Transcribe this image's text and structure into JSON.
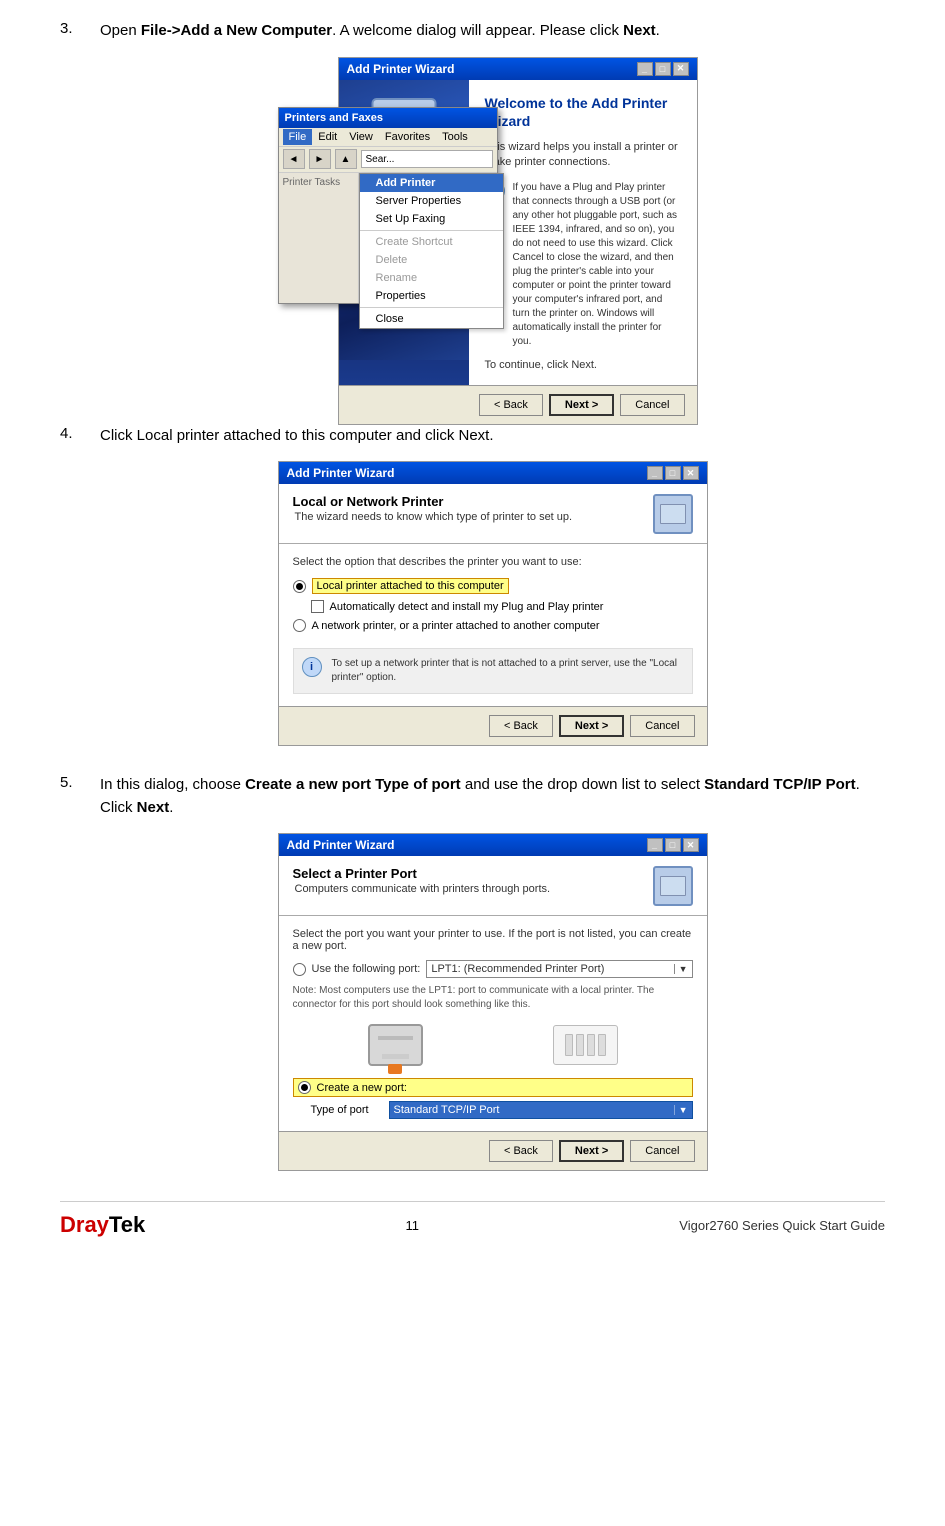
{
  "steps": [
    {
      "number": "3.",
      "text_parts": [
        {
          "text": "Open ",
          "bold": false
        },
        {
          "text": "File->Add a New Computer",
          "bold": true
        },
        {
          "text": ". A welcome dialog will appear. Please click ",
          "bold": false
        },
        {
          "text": "Next",
          "bold": true
        },
        {
          "text": ".",
          "bold": false
        }
      ]
    },
    {
      "number": "4.",
      "text_parts": [
        {
          "text": "Click Local printer attached to this computer and click Next.",
          "bold": false
        }
      ]
    },
    {
      "number": "5.",
      "text_parts": [
        {
          "text": "In this dialog, choose ",
          "bold": false
        },
        {
          "text": "Create a new port Type of port",
          "bold": true
        },
        {
          "text": " and use the drop down list to select ",
          "bold": false
        },
        {
          "text": "Standard TCP/IP Port",
          "bold": true
        },
        {
          "text": ". Click ",
          "bold": false
        },
        {
          "text": "Next",
          "bold": true
        },
        {
          "text": ".",
          "bold": false
        }
      ]
    }
  ],
  "dialogs": {
    "wizard_title": "Add Printer Wizard",
    "welcome_title": "Welcome to the Add Printer Wizard",
    "welcome_desc": "This wizard helps you install a printer or make printer connections.",
    "welcome_info": "If you have a Plug and Play printer that connects through a USB port (or any other hot pluggable port, such as IEEE 1394, infrared, and so on), you do not need to use this wizard. Click Cancel to close the wizard, and then plug the printer's cable into your computer or point the printer toward your computer's infrared port, and turn the printer on. Windows will automatically install the printer for you.",
    "continue_text": "To continue, click Next.",
    "back_btn": "< Back",
    "next_btn": "Next >",
    "cancel_btn": "Cancel",
    "local_title": "Local or Network Printer",
    "local_sub": "The wizard needs to know which type of printer to set up.",
    "select_label": "Select the option that describes the printer you want to use:",
    "radio1": "Local printer attached to this computer",
    "radio1_checkbox": "Automatically detect and install my Plug and Play printer",
    "radio2": "A network printer, or a printer attached to another computer",
    "local_info": "To set up a network printer that is not attached to a print server, use the \"Local printer\" option.",
    "port_title": "Select a Printer Port",
    "port_sub": "Computers communicate with printers through ports.",
    "port_select_label": "Select the port you want your printer to use. If the port is not listed, you can create a new port.",
    "use_port_label": "Use the following port:",
    "port_default": "LPT1: (Recommended Printer Port)",
    "port_note": "Note: Most computers use the LPT1: port to communicate with a local printer. The connector for this port should look something like this.",
    "create_port_label": "Create a new port:",
    "type_label": "Type of port",
    "port_type_value": "Standard TCP/IP Port"
  },
  "printers_window": {
    "title": "Printers and Faxes",
    "menu_items": [
      "File",
      "Edit",
      "View",
      "Favorites",
      "Tools"
    ],
    "active_menu": "File",
    "dropdown_items": [
      {
        "label": "Add Printer",
        "highlighted": true
      },
      {
        "label": "Server Properties",
        "highlighted": false
      },
      {
        "label": "Set Up Faxing",
        "highlighted": false
      },
      {
        "separator": true
      },
      {
        "label": "Create Shortcut",
        "highlighted": false
      },
      {
        "label": "Delete",
        "highlighted": false
      },
      {
        "label": "Rename",
        "highlighted": false
      },
      {
        "label": "Properties",
        "highlighted": false
      },
      {
        "separator": true
      },
      {
        "label": "Close",
        "highlighted": false
      }
    ]
  },
  "footer": {
    "brand_dray": "Dray",
    "brand_tek": "Tek",
    "page_number": "11",
    "product": "Vigor2760  Series  Quick  Start  Guide"
  }
}
